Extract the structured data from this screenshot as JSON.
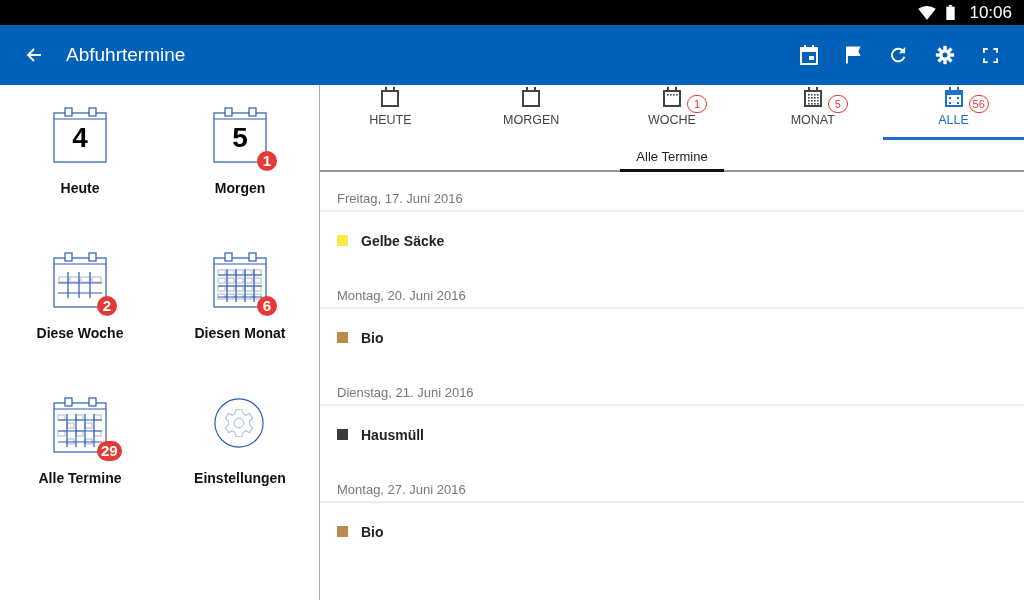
{
  "status_bar": {
    "time": "10:06"
  },
  "app_bar": {
    "title": "Abfuhrtermine"
  },
  "tiles": [
    {
      "kind": "day",
      "day": "4",
      "label": "Heute"
    },
    {
      "kind": "day",
      "day": "5",
      "label": "Morgen",
      "badge": "1"
    },
    {
      "kind": "week",
      "label": "Diese Woche",
      "badge": "2"
    },
    {
      "kind": "month",
      "label": "Diesen Monat",
      "badge": "6"
    },
    {
      "kind": "all",
      "label": "Alle Termine",
      "badge": "29"
    },
    {
      "kind": "settings",
      "label": "Einstellungen"
    }
  ],
  "tabs": [
    {
      "kind": "day",
      "label": "HEUTE",
      "selected": false
    },
    {
      "kind": "day",
      "label": "MORGEN",
      "selected": false
    },
    {
      "kind": "week",
      "label": "WOCHE",
      "badge": "1",
      "selected": false
    },
    {
      "kind": "month",
      "label": "MONAT",
      "badge": "5",
      "selected": false
    },
    {
      "kind": "all",
      "label": "ALLE",
      "badge": "56",
      "selected": true
    }
  ],
  "subtabs": [
    {
      "label": "Alle Termine",
      "selected": true
    }
  ],
  "days": [
    {
      "date": "Freitag, 17. Juni 2016",
      "entries": [
        {
          "name": "Gelbe Säcke",
          "color": "#f7e94a"
        }
      ]
    },
    {
      "date": "Montag, 20. Juni 2016",
      "entries": [
        {
          "name": "Bio",
          "color": "#b98c4e"
        }
      ]
    },
    {
      "date": "Dienstag, 21. Juni 2016",
      "entries": [
        {
          "name": "Hausmüll",
          "color": "#3a3a3a"
        }
      ]
    },
    {
      "date": "Montag, 27. Juni 2016",
      "entries": [
        {
          "name": "Bio",
          "color": "#b98c4e"
        }
      ]
    }
  ]
}
